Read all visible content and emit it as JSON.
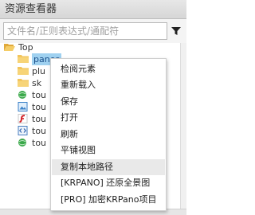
{
  "panel": {
    "title": "资源查看器"
  },
  "search": {
    "placeholder": "文件名/正则表达式/通配符"
  },
  "tree": {
    "root_label": "Top",
    "items": [
      {
        "label": "panos",
        "icon": "folder-icon",
        "selected": true
      },
      {
        "label": "plu",
        "icon": "folder-icon"
      },
      {
        "label": "sk",
        "icon": "folder-icon"
      },
      {
        "label": "tou",
        "icon": "globe-file-icon"
      },
      {
        "label": "tou",
        "icon": "image-file-icon"
      },
      {
        "label": "tou",
        "icon": "flash-file-icon"
      },
      {
        "label": "tou",
        "icon": "xml-file-icon"
      },
      {
        "label": "tou",
        "icon": "globe-file-icon"
      }
    ]
  },
  "context_menu": {
    "items": [
      "检阅元素",
      "重新载入",
      "保存",
      "打开",
      "刷新",
      "平铺视图",
      "复制本地路径",
      "[KRPANO] 还原全景图",
      "[PRO] 加密KRPano项目"
    ],
    "highlighted_index": 6
  },
  "colors": {
    "selection": "#9fd1f0",
    "folder": "#f2c55c",
    "menu_highlight": "#e9e9e9"
  }
}
